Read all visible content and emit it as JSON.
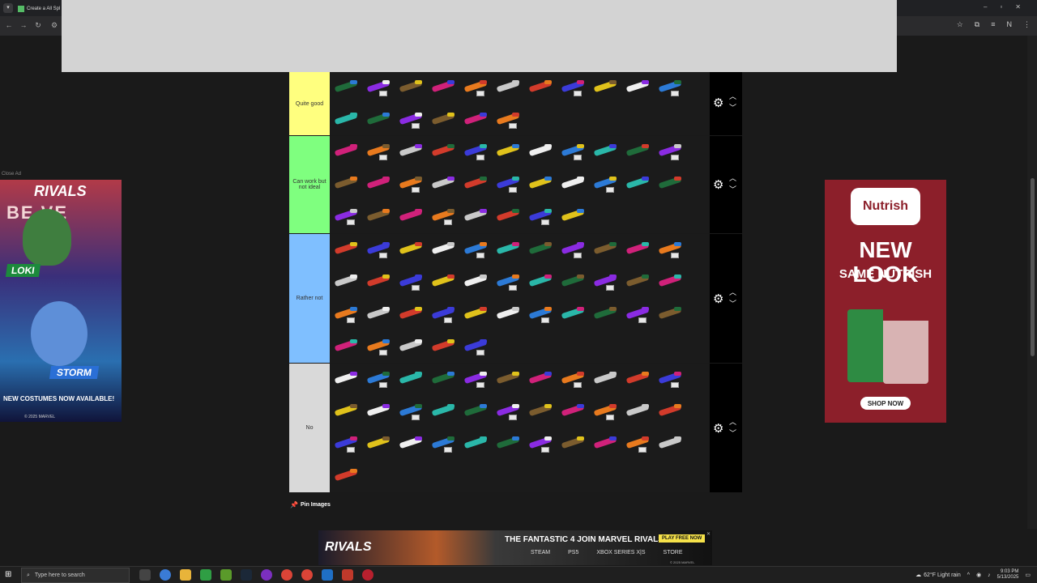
{
  "browser": {
    "tab_title": "Create a All Spl",
    "tab_menu_icon": "chevron-down",
    "nav_icons": [
      "back-icon",
      "forward-icon",
      "reload-icon",
      "site-info-icon"
    ],
    "window_controls": [
      "–",
      "▫",
      "✕"
    ]
  },
  "tiers": [
    {
      "label": "Quite good",
      "color": "#ffff7f",
      "item_count": 17
    },
    {
      "label": "Can work but not ideal",
      "color": "#7fff7f",
      "item_count": 30
    },
    {
      "label": "Rather not",
      "color": "#7fbfff",
      "item_count": 38
    },
    {
      "label": "No",
      "color": "#d9d9d9",
      "item_count": 34
    }
  ],
  "pin_images_label": "Pin Images",
  "ads": {
    "left": {
      "close_label": "Close Ad",
      "brand": "RIVALS",
      "headline": "BE VE",
      "hero1": "LOKI",
      "hero2": "STORM",
      "cta": "NEW COSTUMES NOW AVAILABLE!",
      "copyright": "© 2025 MARVEL"
    },
    "right": {
      "brand": "Nutrish",
      "headline": "NEW LOOK",
      "subheadline": "SAME NUTRISH",
      "cta": "SHOP NOW"
    },
    "bottom": {
      "brand": "RIVALS",
      "text": "THE FANTASTIC 4 JOIN MARVEL RIVALS!",
      "button": "PLAY FREE NOW",
      "platforms": [
        "STEAM",
        "PS5",
        "XBOX SERIES X|S",
        "STORE"
      ],
      "copyright": "© 2025 MARVEL"
    }
  },
  "taskbar": {
    "search_placeholder": "Type here to search",
    "weather": "62°F  Light rain",
    "time": "9:03 PM",
    "date": "5/13/2025"
  },
  "palette": [
    "#1f6b3a",
    "#c9c9c9",
    "#2c7ad6",
    "#d0217a",
    "#e0c21b",
    "#8a2be2",
    "#d23b2b",
    "#2ab7a9",
    "#e87a1e",
    "#efefef",
    "#7b5c2e",
    "#3b3bd9"
  ]
}
